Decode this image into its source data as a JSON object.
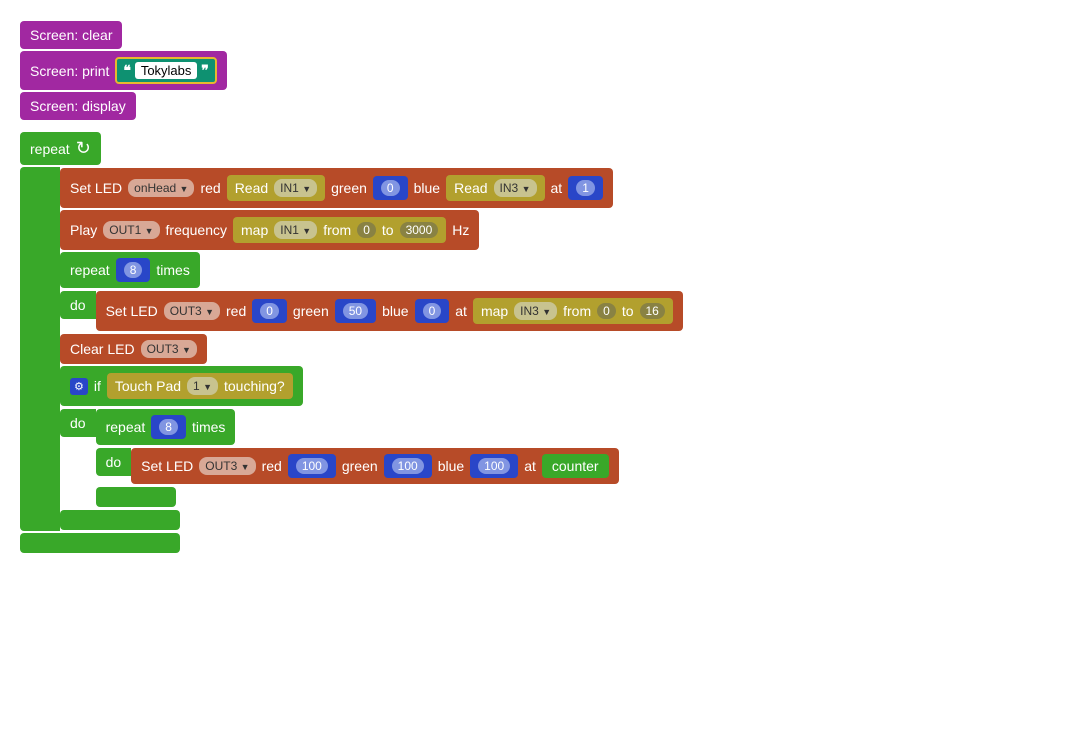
{
  "screen": {
    "clear": "Screen: clear",
    "print": "Screen: print",
    "display": "Screen: display",
    "text": "Tokylabs"
  },
  "repeat": "repeat",
  "times": "times",
  "do": "do",
  "if": "if",
  "setled": "Set LED",
  "clearled": "Clear LED",
  "red": "red",
  "green": "green",
  "blue": "blue",
  "at": "at",
  "play": "Play",
  "frequency": "frequency",
  "hz": "Hz",
  "read": "Read",
  "map": "map",
  "from": "from",
  "to": "to",
  "touchpad": "Touch Pad",
  "touching": "touching?",
  "counter": "counter",
  "dd": {
    "onHead": "onHead",
    "IN1": "IN1",
    "IN3": "IN3",
    "OUT1": "OUT1",
    "OUT3": "OUT3",
    "pad1": "1"
  },
  "n": {
    "zero": "0",
    "one": "1",
    "eight": "8",
    "fifty": "50",
    "hundred": "100",
    "threek": "3000",
    "sixteen": "16"
  }
}
